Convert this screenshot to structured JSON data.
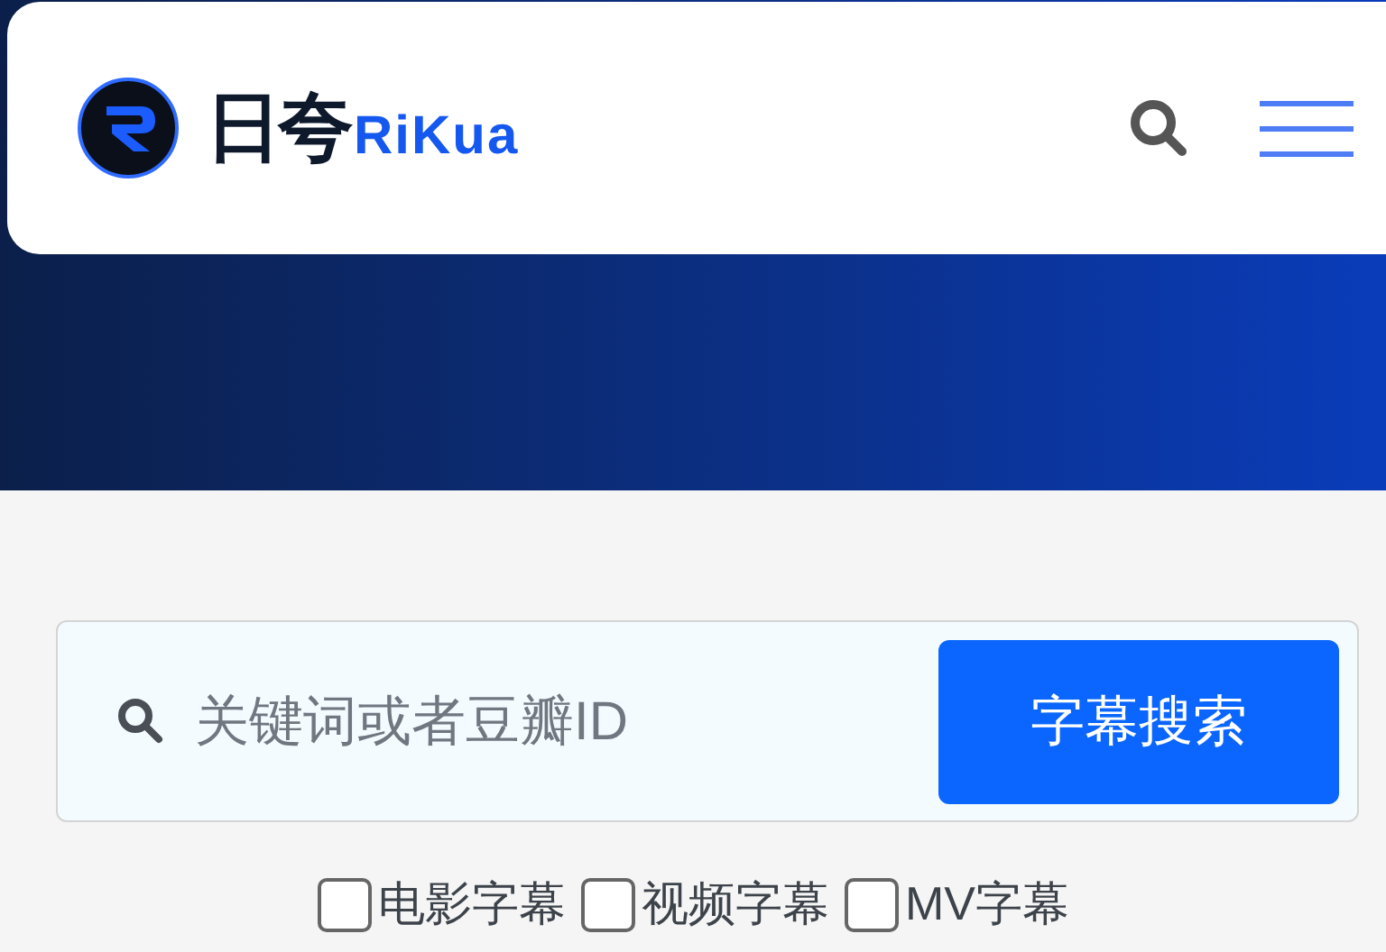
{
  "header": {
    "logo_cn": "日夸",
    "logo_en": "RiKua"
  },
  "search": {
    "placeholder": "关键词或者豆瓣ID",
    "button": "字幕搜索"
  },
  "filters": [
    {
      "label": "电影字幕",
      "checked": false
    },
    {
      "label": "视频字幕",
      "checked": false
    },
    {
      "label": "MV字幕",
      "checked": false
    }
  ]
}
